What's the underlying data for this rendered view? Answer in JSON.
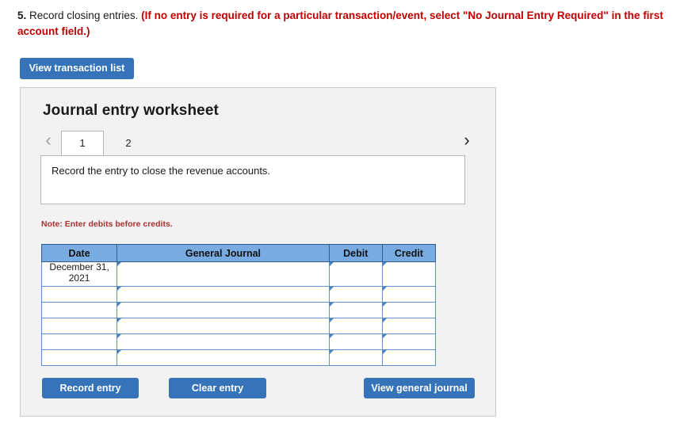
{
  "question": {
    "number": "5.",
    "text": "Record closing entries.",
    "note": "(If no entry is required for a particular transaction/event, select \"No Journal Entry Required\" in the first account field.)"
  },
  "toolbar": {
    "view_transaction_list_label": "View transaction list"
  },
  "worksheet": {
    "title": "Journal entry worksheet",
    "tabs": [
      {
        "label": "1",
        "active": true
      },
      {
        "label": "2",
        "active": false
      }
    ],
    "prev_arrow": "‹",
    "next_arrow": "›",
    "instruction": "Record the entry to close the revenue accounts.",
    "note": "Note: Enter debits before credits."
  },
  "table": {
    "headers": [
      "Date",
      "General Journal",
      "Debit",
      "Credit"
    ],
    "rows": [
      {
        "date": "December 31, 2021",
        "general_journal": "",
        "debit": "",
        "credit": ""
      },
      {
        "date": "",
        "general_journal": "",
        "debit": "",
        "credit": ""
      },
      {
        "date": "",
        "general_journal": "",
        "debit": "",
        "credit": ""
      },
      {
        "date": "",
        "general_journal": "",
        "debit": "",
        "credit": ""
      },
      {
        "date": "",
        "general_journal": "",
        "debit": "",
        "credit": ""
      },
      {
        "date": "",
        "general_journal": "",
        "debit": "",
        "credit": ""
      }
    ]
  },
  "actions": {
    "record_entry_label": "Record entry",
    "clear_entry_label": "Clear entry",
    "view_general_journal_label": "View general journal"
  },
  "colors": {
    "button_blue": "#3673b8",
    "header_blue": "#79abe3",
    "note_red": "#a83232",
    "prompt_red": "#c00000",
    "panel_bg": "#f2f2f2",
    "cell_border_blue": "#5b90c8"
  }
}
